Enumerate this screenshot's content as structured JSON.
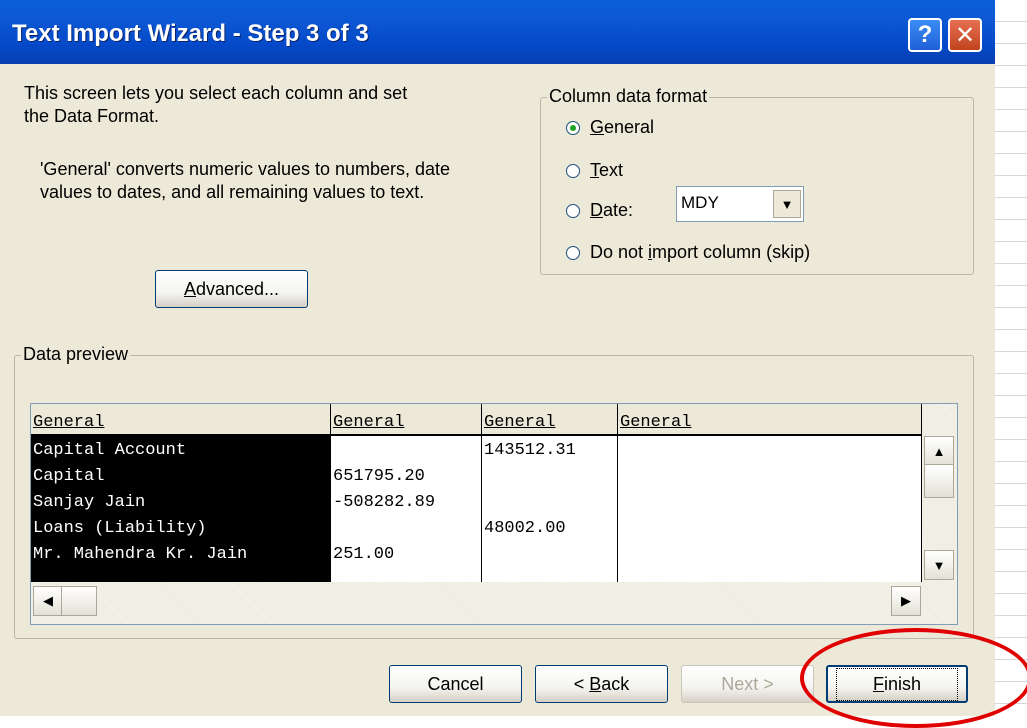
{
  "window": {
    "title": "Text Import Wizard - Step 3 of 3",
    "help_glyph": "?",
    "close_glyph": "✕"
  },
  "intro": {
    "line1": "This screen lets you select each column and set",
    "line2": "the Data Format.",
    "general_line1": "'General' converts numeric values to numbers, date",
    "general_line2": "values to dates, and all remaining values to text."
  },
  "advanced_button": {
    "pre": "",
    "underline": "A",
    "post": "dvanced..."
  },
  "column_format": {
    "legend": "Column data format",
    "options": [
      {
        "pre": "",
        "underline": "G",
        "post": "eneral",
        "checked": true
      },
      {
        "pre": "",
        "underline": "T",
        "post": "ext",
        "checked": false
      },
      {
        "pre": "",
        "underline": "D",
        "post": "ate:",
        "checked": false
      },
      {
        "pre": "Do not ",
        "underline": "i",
        "post": "mport column (skip)",
        "checked": false
      }
    ],
    "date_value": "MDY",
    "dropdown_glyph": "▼"
  },
  "preview": {
    "legend": "Data preview",
    "headers": [
      "General",
      "General",
      "General",
      "General"
    ],
    "col1": [
      "Capital Account",
      "Capital",
      "Sanjay Jain",
      "Loans (Liability)",
      "Mr. Mahendra Kr. Jain"
    ],
    "col2": [
      "",
      "651795.20",
      "-508282.89",
      "",
      "251.00"
    ],
    "col3": [
      "143512.31",
      "",
      "",
      "48002.00",
      ""
    ],
    "scroll_up": "▲",
    "scroll_down": "▼",
    "scroll_left": "◀",
    "scroll_right": "▶"
  },
  "footer": {
    "cancel": "Cancel",
    "back": {
      "pre": "< ",
      "underline": "B",
      "post": "ack"
    },
    "next": "Next >",
    "finish": {
      "pre": "",
      "underline": "F",
      "post": "inish"
    }
  },
  "colors": {
    "title_bar": "#0449c9",
    "dialog_bg": "#ece9d8",
    "callout": "#e00000"
  }
}
